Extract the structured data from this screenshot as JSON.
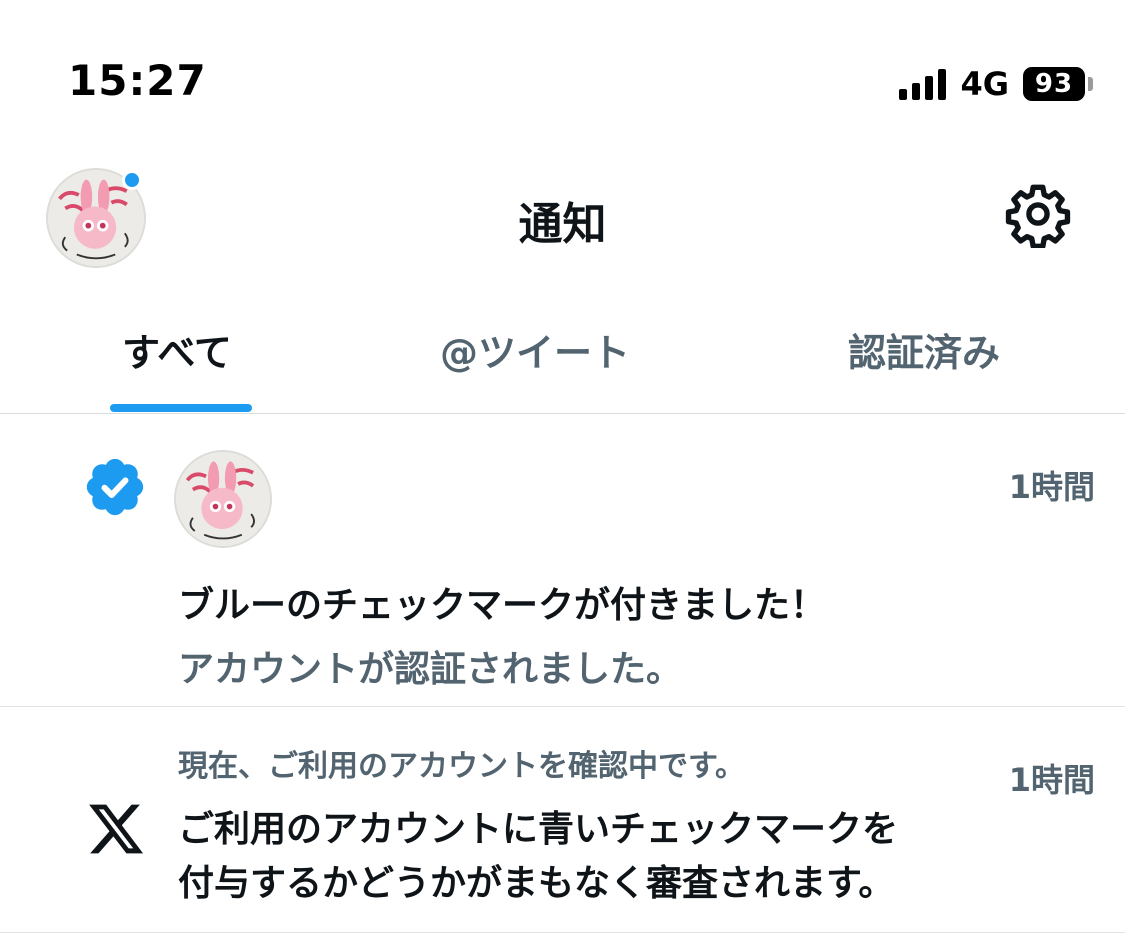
{
  "status_bar": {
    "time": "15:27",
    "network": "4G",
    "battery": "93"
  },
  "header": {
    "title": "通知",
    "avatar_icon": "profile-avatar",
    "settings_icon": "gear-icon"
  },
  "tabs": [
    {
      "label": "すべて",
      "active": true
    },
    {
      "label": "@ツイート",
      "active": false
    },
    {
      "label": "認証済み",
      "active": false
    }
  ],
  "notifications": [
    {
      "icon": "verified-badge-icon",
      "time": "1時間",
      "title": "ブルーのチェックマークが付きました！",
      "subtitle": "アカウントが認証されました。"
    },
    {
      "icon": "x-logo-icon",
      "time": "1時間",
      "subtitle": "現在、ご利用のアカウントを確認中です。",
      "body_lines": [
        "ご利用のアカウントに青いチェックマークを",
        "付与するかどうかがまもなく審査されます。"
      ]
    }
  ],
  "colors": {
    "accent": "#1d9bf0",
    "text_primary": "#0f1419",
    "text_secondary": "#536471"
  }
}
